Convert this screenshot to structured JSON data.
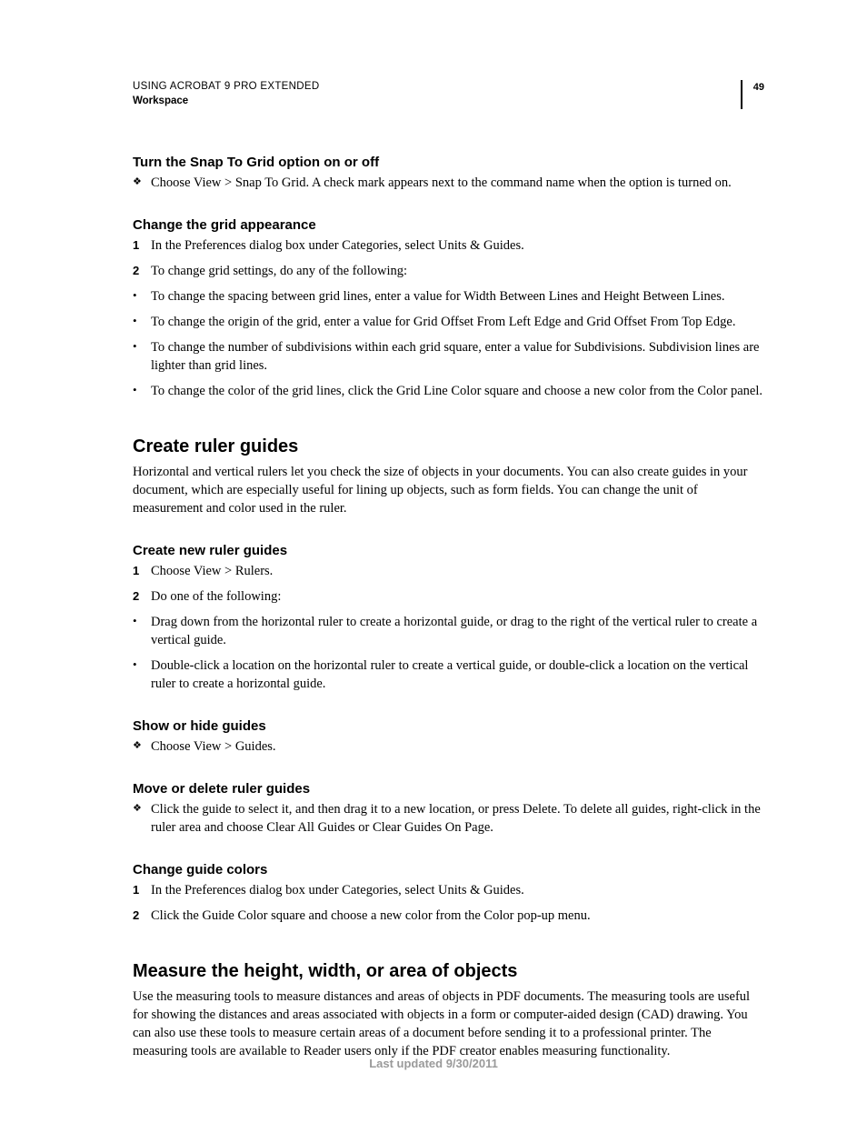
{
  "header": {
    "title": "USING ACROBAT 9 PRO EXTENDED",
    "section": "Workspace",
    "page_number": "49"
  },
  "s1": {
    "heading": "Turn the Snap To Grid option on or off",
    "item": "Choose View > Snap To Grid. A check mark appears next to the command name when the option is turned on."
  },
  "s2": {
    "heading": "Change the grid appearance",
    "n1": "In the Preferences dialog box under Categories, select Units & Guides.",
    "n2": "To change grid settings, do any of the following:",
    "b1": "To change the spacing between grid lines, enter a value for Width Between Lines and Height Between Lines.",
    "b2": "To change the origin of the grid, enter a value for Grid Offset From Left Edge and Grid Offset From Top Edge.",
    "b3": "To change the number of subdivisions within each grid square, enter a value for Subdivisions. Subdivision lines are lighter than grid lines.",
    "b4": "To change the color of the grid lines, click the Grid Line Color square and choose a new color from the Color panel."
  },
  "s3": {
    "heading": "Create ruler guides",
    "intro": "Horizontal and vertical rulers let you check the size of objects in your documents. You can also create guides in your document, which are especially useful for lining up objects, such as form fields. You can change the unit of measurement and color used in the ruler."
  },
  "s4": {
    "heading": "Create new ruler guides",
    "n1": "Choose View > Rulers.",
    "n2": "Do one of the following:",
    "b1": "Drag down from the horizontal ruler to create a horizontal guide, or drag to the right of the vertical ruler to create a vertical guide.",
    "b2": "Double-click a location on the horizontal ruler to create a vertical guide, or double-click a location on the vertical ruler to create a horizontal guide."
  },
  "s5": {
    "heading": "Show or hide guides",
    "item": "Choose View > Guides."
  },
  "s6": {
    "heading": "Move or delete ruler guides",
    "item": "Click the guide to select it, and then drag it to a new location, or press Delete. To delete all guides, right-click in the ruler area and choose Clear All Guides or Clear Guides On Page."
  },
  "s7": {
    "heading": "Change guide colors",
    "n1": "In the Preferences dialog box under Categories, select Units & Guides.",
    "n2": "Click the Guide Color square and choose a new color from the Color pop-up menu."
  },
  "s8": {
    "heading": "Measure the height, width, or area of objects",
    "intro": "Use the measuring tools to measure distances and areas of objects in PDF documents. The measuring tools are useful for showing the distances and areas associated with objects in a form or computer-aided design (CAD) drawing. You can also use these tools to measure certain areas of a document before sending it to a professional printer. The measuring tools are available to Reader users only if the PDF creator enables measuring functionality."
  },
  "footer": "Last updated 9/30/2011"
}
